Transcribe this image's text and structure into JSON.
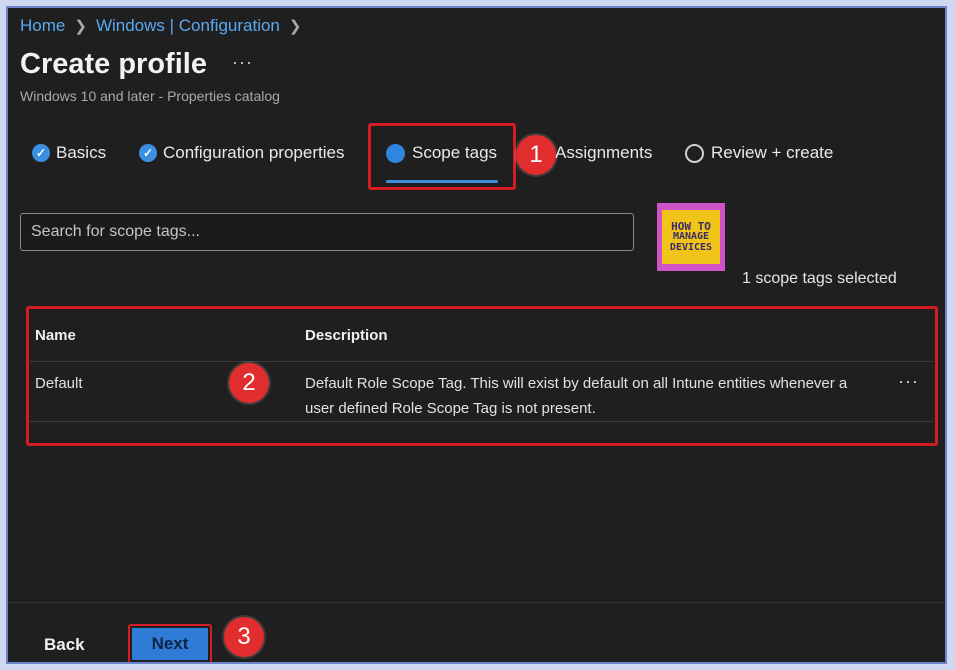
{
  "breadcrumb": {
    "home": "Home",
    "section": "Windows | Configuration"
  },
  "page": {
    "title": "Create profile",
    "more": "···",
    "subtitle": "Windows 10 and later - Properties catalog"
  },
  "steps": [
    {
      "label": "Basics",
      "state": "complete"
    },
    {
      "label": "Configuration properties",
      "state": "complete"
    },
    {
      "label": "Scope tags",
      "state": "current"
    },
    {
      "label": "Assignments",
      "state": "pending"
    },
    {
      "label": "Review + create",
      "state": "pending"
    }
  ],
  "search": {
    "placeholder": "Search for scope tags..."
  },
  "logo": {
    "line1": "HOW TO",
    "line2": "MANAGE",
    "line3": "DEVICES"
  },
  "selected_count": "1 scope tags selected",
  "table": {
    "columns": [
      "Name",
      "Description"
    ],
    "rows": [
      {
        "name": "Default",
        "description_line1": "Default Role Scope Tag. This will exist by default on all Intune entities whenever a",
        "description_line2": "user defined Role Scope Tag is not present.",
        "more": "···"
      }
    ]
  },
  "annotations": [
    "1",
    "2",
    "3"
  ],
  "footer": {
    "back": "Back",
    "next": "Next"
  },
  "colors": {
    "accent": "#3b8fe0",
    "annotation": "#d41c25",
    "background": "#1f1f1f"
  }
}
